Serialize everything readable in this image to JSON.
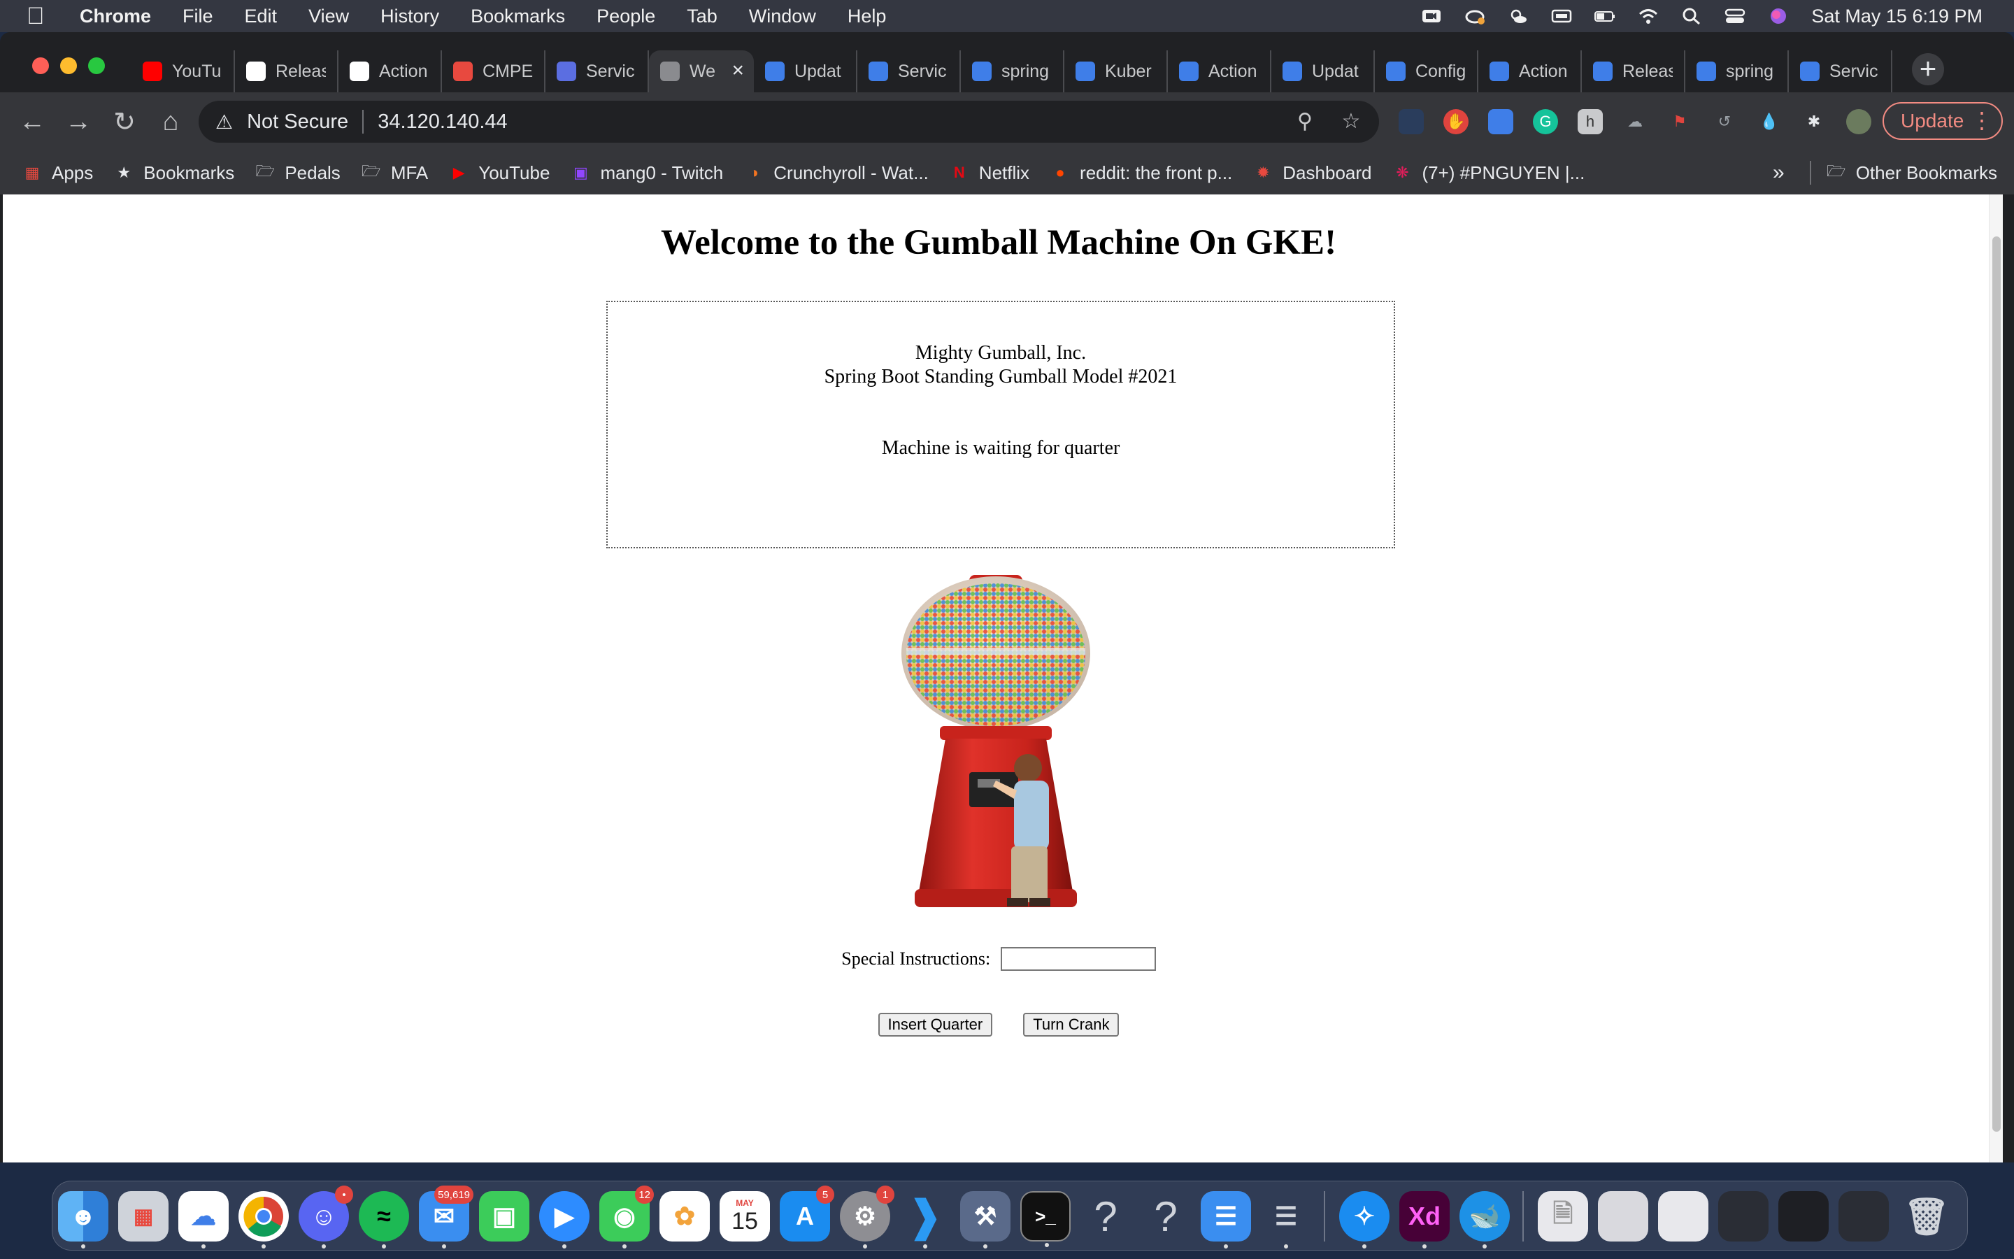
{
  "menubar": {
    "app_name": "Chrome",
    "menus": [
      "File",
      "Edit",
      "View",
      "History",
      "Bookmarks",
      "People",
      "Tab",
      "Window",
      "Help"
    ],
    "clock": "Sat May 15  6:19 PM"
  },
  "tabs": [
    {
      "label": "YouTu",
      "icon": "youtube-icon",
      "color": "#ff0000"
    },
    {
      "label": "Releas",
      "icon": "github-icon",
      "color": "#ffffff"
    },
    {
      "label": "Action",
      "icon": "github-icon",
      "color": "#ffffff"
    },
    {
      "label": "CMPE",
      "icon": "cmpe-icon",
      "color": "#e8493f"
    },
    {
      "label": "Servic",
      "icon": "kubernetes-icon",
      "color": "#5b6ee1"
    },
    {
      "label": "We",
      "icon": "globe-icon",
      "color": "#8a8b8f",
      "active": true
    },
    {
      "label": "Updat",
      "icon": "cloud-icon",
      "color": "#3f7ee8"
    },
    {
      "label": "Servic",
      "icon": "cloud-icon",
      "color": "#3f7ee8"
    },
    {
      "label": "spring",
      "icon": "cloud-icon",
      "color": "#3f7ee8"
    },
    {
      "label": "Kuber",
      "icon": "cloud-icon",
      "color": "#3f7ee8"
    },
    {
      "label": "Action",
      "icon": "cloud-icon",
      "color": "#3f7ee8"
    },
    {
      "label": "Updat",
      "icon": "cloud-icon",
      "color": "#3f7ee8"
    },
    {
      "label": "Config",
      "icon": "cloud-icon",
      "color": "#3f7ee8"
    },
    {
      "label": "Action",
      "icon": "cloud-icon",
      "color": "#3f7ee8"
    },
    {
      "label": "Releas",
      "icon": "cloud-icon",
      "color": "#3f7ee8"
    },
    {
      "label": "spring",
      "icon": "cloud-icon",
      "color": "#3f7ee8"
    },
    {
      "label": "Servic",
      "icon": "cloud-icon",
      "color": "#3f7ee8"
    }
  ],
  "address_bar": {
    "security_label": "Not Secure",
    "url": "34.120.140.44"
  },
  "update_button": "Update",
  "bookmarks": [
    {
      "label": "Apps",
      "icon": "apps-grid-icon"
    },
    {
      "label": "Bookmarks",
      "icon": "star-icon"
    },
    {
      "label": "Pedals",
      "icon": "folder-icon"
    },
    {
      "label": "MFA",
      "icon": "folder-icon"
    },
    {
      "label": "YouTube",
      "icon": "youtube-icon"
    },
    {
      "label": "mang0 - Twitch",
      "icon": "twitch-icon"
    },
    {
      "label": "Crunchyroll - Wat...",
      "icon": "crunchyroll-icon"
    },
    {
      "label": "Netflix",
      "icon": "netflix-icon"
    },
    {
      "label": "reddit: the front p...",
      "icon": "reddit-icon"
    },
    {
      "label": "Dashboard",
      "icon": "dashboard-icon"
    },
    {
      "label": "(7+) #PNGUYEN |...",
      "icon": "slack-icon"
    }
  ],
  "bookmarks_overflow": "»",
  "other_bookmarks": "Other Bookmarks",
  "page": {
    "heading": "Welcome to the Gumball Machine On GKE!",
    "company": "Mighty Gumball, Inc.",
    "model": "Spring Boot Standing Gumball Model #2021",
    "status": "Machine is waiting for quarter",
    "special_instructions_label": "Special Instructions:",
    "special_instructions_value": "",
    "insert_quarter_label": "Insert Quarter",
    "turn_crank_label": "Turn Crank"
  },
  "dock": {
    "mail_badge": "59,619",
    "messages_badge": "12",
    "appstore_badge": "5",
    "settings_badge": "1",
    "discord_badge": "•",
    "calendar_month": "MAY",
    "calendar_day": "15"
  }
}
